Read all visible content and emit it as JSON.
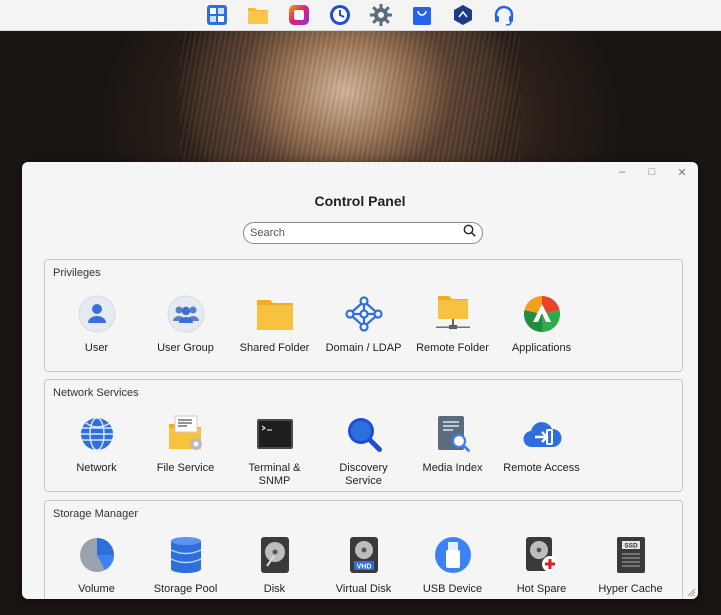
{
  "taskbar": {
    "icons": [
      "grid-app-icon",
      "folder-icon",
      "photos-icon",
      "clock-icon",
      "gear-icon",
      "shopping-bag-icon",
      "shield-icon",
      "headset-icon"
    ]
  },
  "window": {
    "title": "Control Panel",
    "controls": {
      "minimize": "–",
      "maximize": "□",
      "close": "✕"
    }
  },
  "search": {
    "placeholder": "Search",
    "value": ""
  },
  "sections": [
    {
      "title": "Privileges",
      "items": [
        {
          "label": "User",
          "icon": "user-icon"
        },
        {
          "label": "User Group",
          "icon": "user-group-icon"
        },
        {
          "label": "Shared Folder",
          "icon": "folder-icon"
        },
        {
          "label": "Domain / LDAP",
          "icon": "network-nodes-icon"
        },
        {
          "label": "Remote Folder",
          "icon": "remote-folder-icon"
        },
        {
          "label": "Applications",
          "icon": "applications-icon"
        }
      ]
    },
    {
      "title": "Network Services",
      "items": [
        {
          "label": "Network",
          "icon": "globe-icon"
        },
        {
          "label": "File Service",
          "icon": "file-service-icon"
        },
        {
          "label": "Terminal &\nSNMP",
          "icon": "terminal-icon"
        },
        {
          "label": "Discovery\nService",
          "icon": "magnifier-icon"
        },
        {
          "label": "Media Index",
          "icon": "media-index-icon"
        },
        {
          "label": "Remote Access",
          "icon": "cloud-login-icon"
        }
      ]
    },
    {
      "title": "Storage Manager",
      "items": [
        {
          "label": "Volume",
          "icon": "pie-volume-icon"
        },
        {
          "label": "Storage Pool",
          "icon": "database-icon"
        },
        {
          "label": "Disk",
          "icon": "hard-disk-icon"
        },
        {
          "label": "Virtual Disk",
          "icon": "vhd-disk-icon"
        },
        {
          "label": "USB Device",
          "icon": "usb-icon"
        },
        {
          "label": "Hot Spare",
          "icon": "hot-spare-icon"
        },
        {
          "label": "Hyper Cache",
          "icon": "ssd-icon"
        }
      ]
    }
  ],
  "icon_text": {
    "vhd": "VHD",
    "ssd": "SSD"
  },
  "colors": {
    "accent_blue": "#2f6fdc",
    "folder_yellow": "#f7c23e",
    "window_bg": "#f5f5f5"
  }
}
